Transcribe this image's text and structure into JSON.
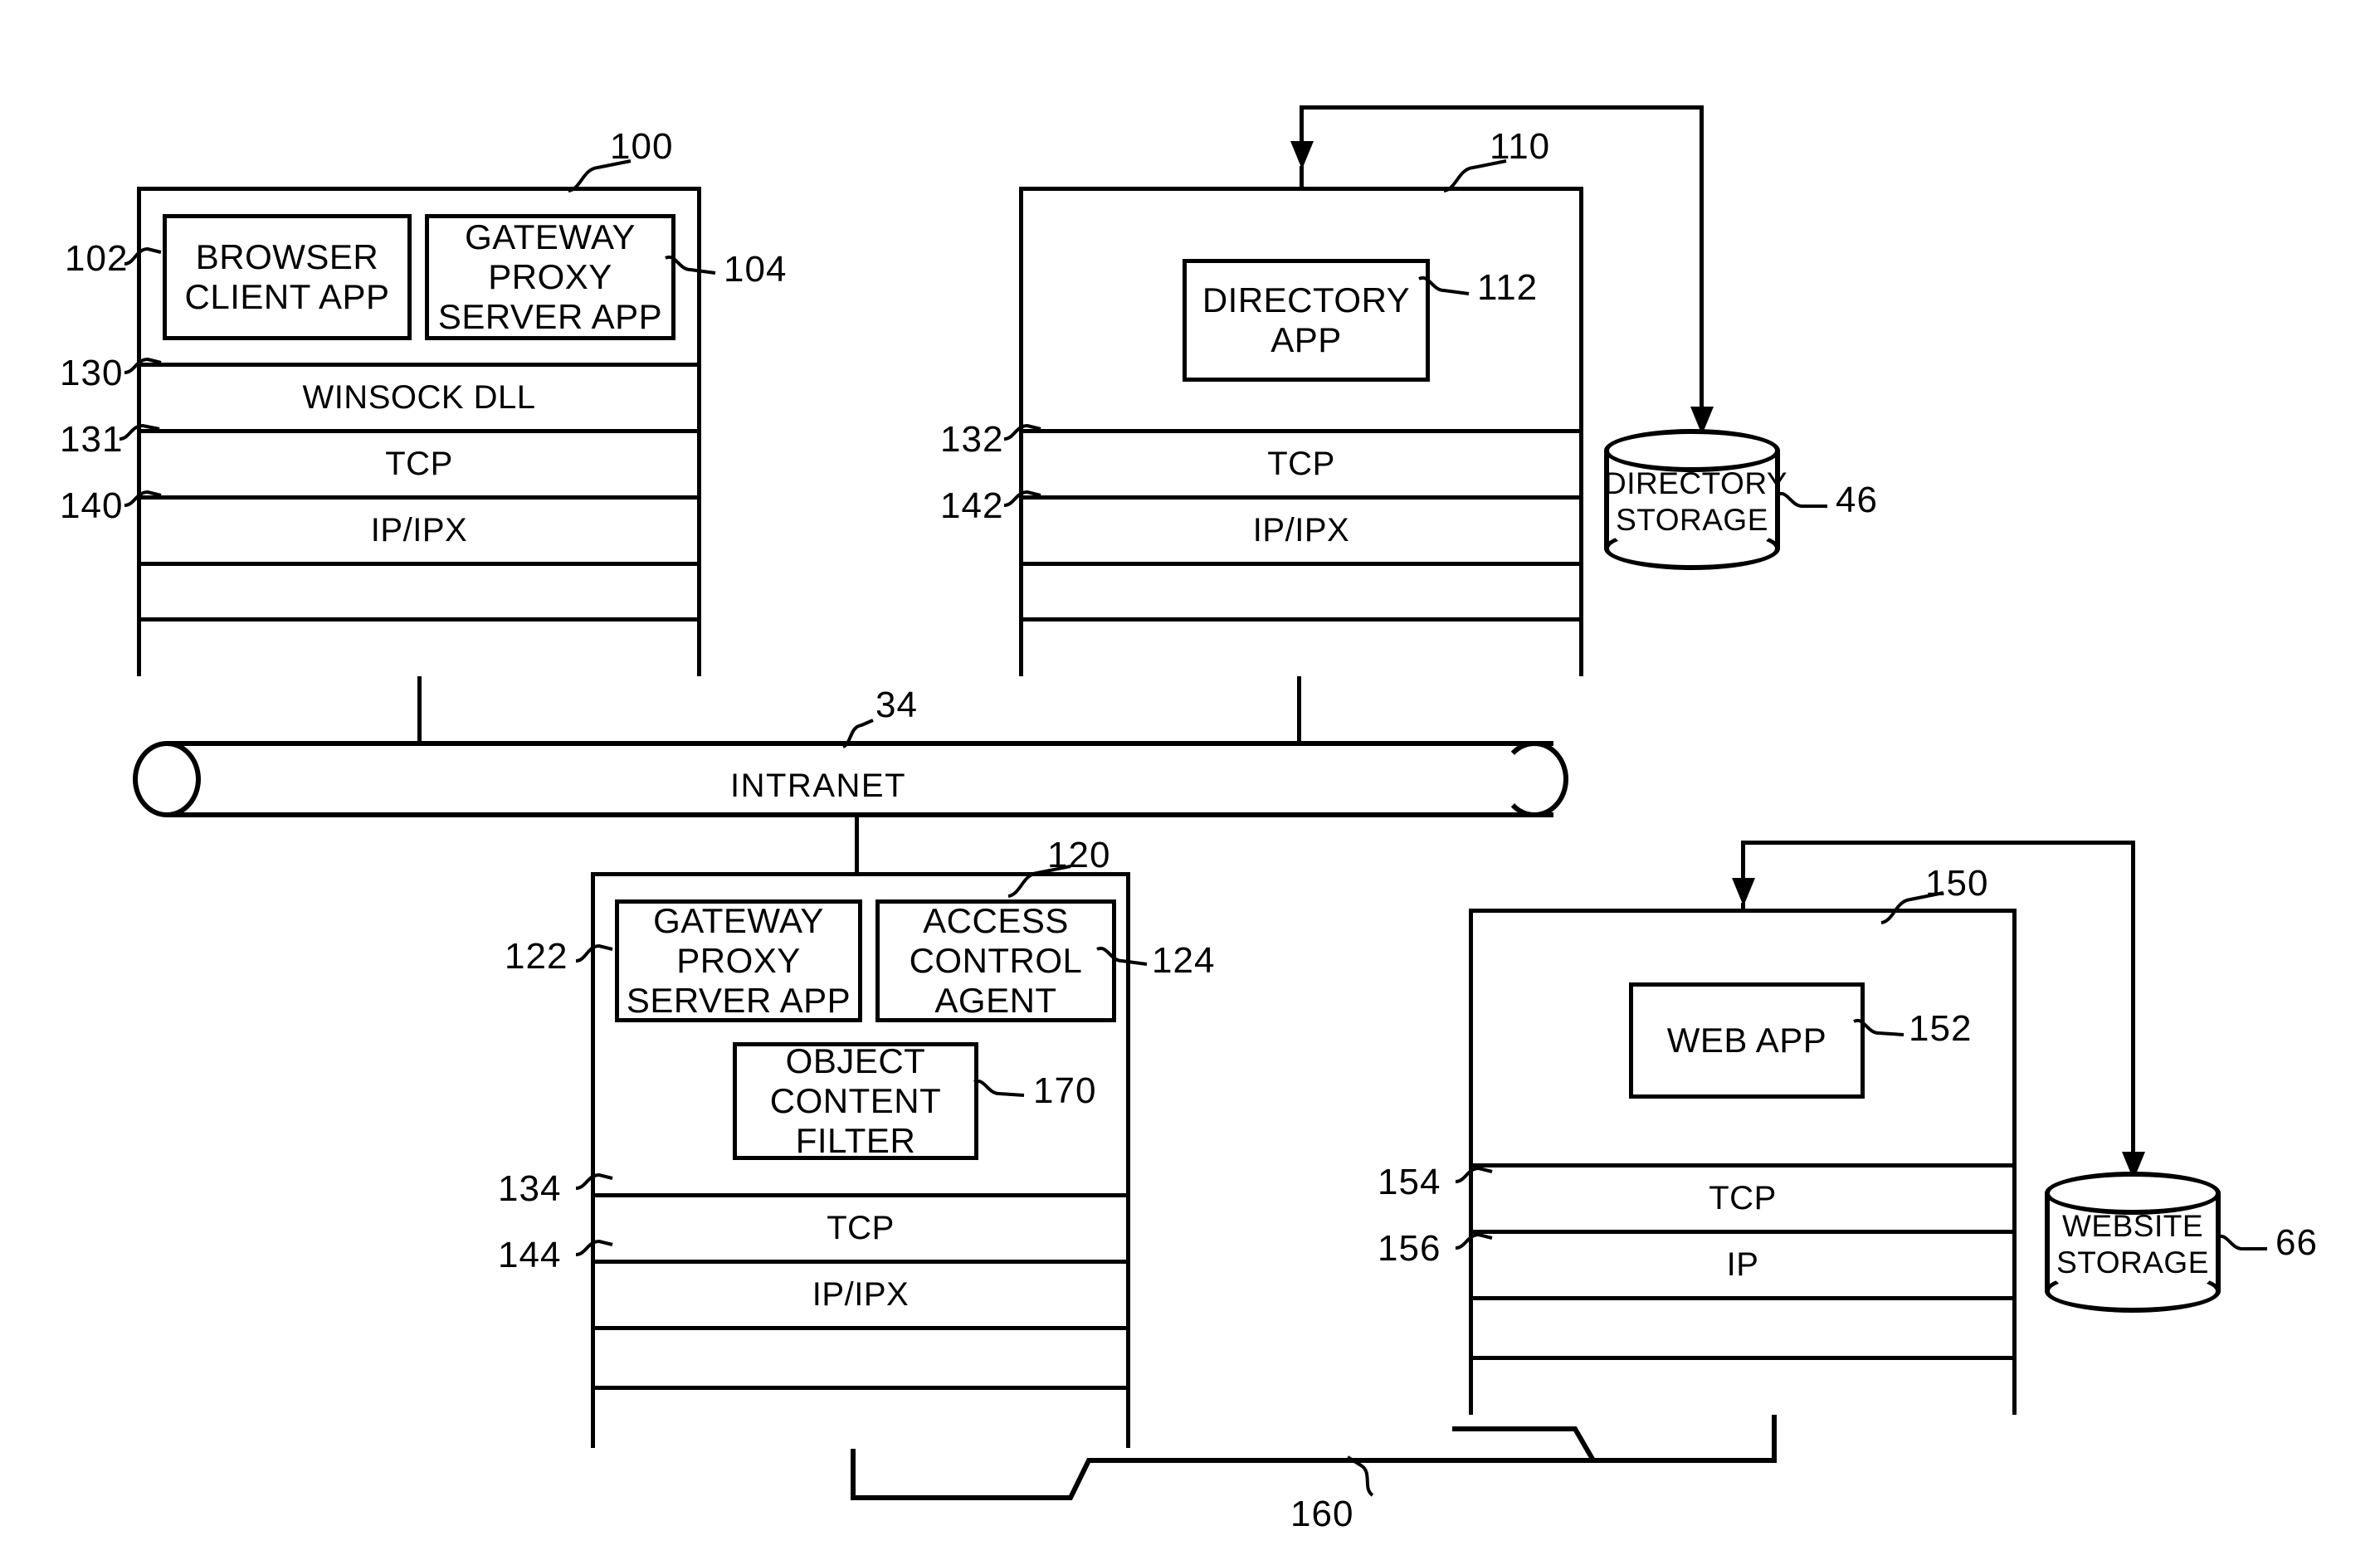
{
  "figure": {
    "type": "patent-network-architecture-diagram",
    "network_label": "INTRANET",
    "network_ref": "34"
  },
  "client_workstation": {
    "ref": "100",
    "apps": [
      {
        "ref": "102",
        "label": "BROWSER\nCLIENT APP",
        "line1": "BROWSER",
        "line2": "CLIENT APP"
      },
      {
        "ref": "104",
        "label": "GATEWAY PROXY\nSERVER APP",
        "line1": "GATEWAY PROXY",
        "line2": "SERVER APP"
      }
    ],
    "layers": [
      {
        "ref": "130",
        "label": "WINSOCK DLL"
      },
      {
        "ref": "131",
        "label": "TCP"
      },
      {
        "ref": "140",
        "label": "IP/IPX"
      },
      {
        "ref": "",
        "label": ""
      },
      {
        "ref": "",
        "label": ""
      }
    ]
  },
  "directory_server": {
    "ref": "110",
    "apps": [
      {
        "ref": "112",
        "line1": "DIRECTORY",
        "line2": "APP"
      }
    ],
    "layers": [
      {
        "ref": "132",
        "label": "TCP"
      },
      {
        "ref": "142",
        "label": "IP/IPX"
      },
      {
        "ref": "",
        "label": ""
      },
      {
        "ref": "",
        "label": ""
      }
    ]
  },
  "directory_storage": {
    "ref": "46",
    "line1": "DIRECTORY",
    "line2": "STORAGE"
  },
  "proxy_server": {
    "ref": "120",
    "apps": [
      {
        "ref": "122",
        "line1": "GATEWAY PROXY",
        "line2": "SERVER APP"
      },
      {
        "ref": "124",
        "line1": "ACCESS",
        "line2": "CONTROL AGENT"
      },
      {
        "ref": "170",
        "line1": "OBJECT",
        "line2": "CONTENT FILTER"
      }
    ],
    "layers": [
      {
        "ref": "134",
        "label": "TCP"
      },
      {
        "ref": "144",
        "label": "IP/IPX"
      },
      {
        "ref": "",
        "label": ""
      },
      {
        "ref": "",
        "label": ""
      }
    ]
  },
  "web_server": {
    "ref": "150",
    "apps": [
      {
        "ref": "152",
        "line1": "WEB APP",
        "line2": ""
      }
    ],
    "layers": [
      {
        "ref": "154",
        "label": "TCP"
      },
      {
        "ref": "156",
        "label": "IP"
      },
      {
        "ref": "",
        "label": ""
      },
      {
        "ref": "",
        "label": ""
      }
    ]
  },
  "website_storage": {
    "ref": "66",
    "line1": "WEBSITE",
    "line2": "STORAGE"
  },
  "external_link": {
    "ref": "160"
  }
}
